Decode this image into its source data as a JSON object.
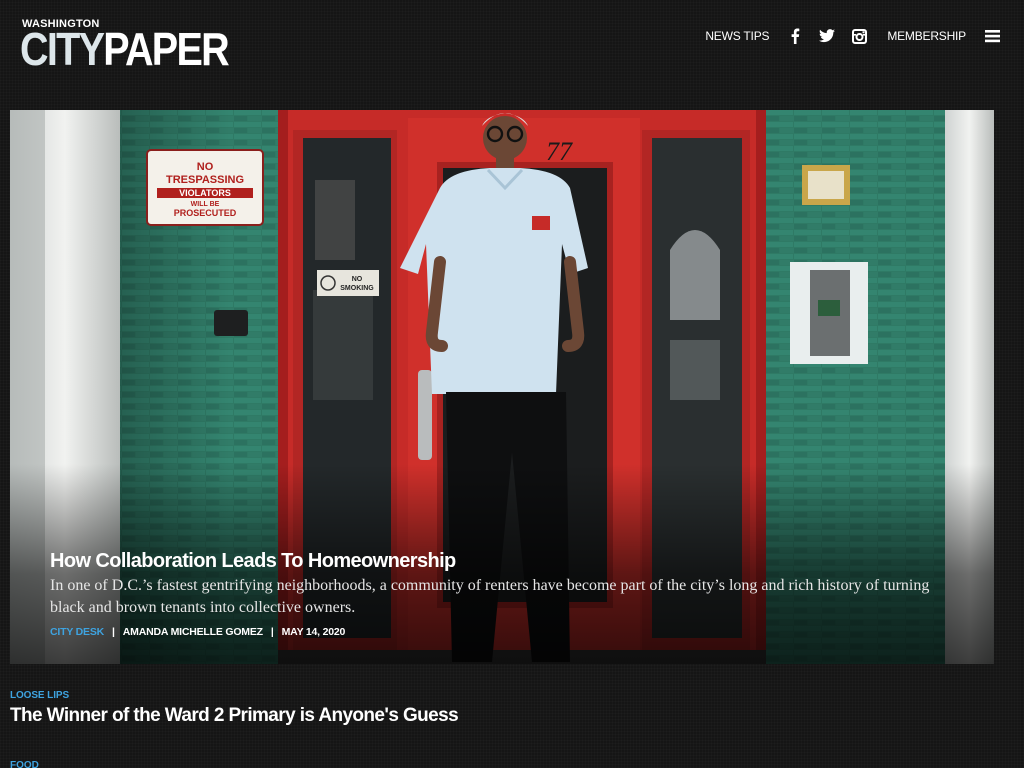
{
  "logo": {
    "small": "WASHINGTON",
    "city": "CITY",
    "paper": "PAPER"
  },
  "nav": {
    "news_tips": "NEWS TIPS",
    "membership": "MEMBERSHIP",
    "icons": [
      "facebook-icon",
      "twitter-icon",
      "instagram-icon",
      "menu-icon"
    ]
  },
  "hero": {
    "sign_no": "NO",
    "sign_trespassing": "TRESPASSING",
    "sign_violators": "VIOLATORS",
    "sign_will_be": "WILL BE",
    "sign_prosecuted": "PROSECUTED",
    "sign_no_smoking_1": "NO",
    "sign_no_smoking_2": "SMOKING",
    "door_number": "77",
    "title": "How Collaboration Leads To Homeownership",
    "description": "In one of D.C.’s fastest gentrifying neighborhoods, a community of renters have become part of the city’s long and rich history of turning black and brown tenants into collective owners.",
    "category": "CITY DESK",
    "separator": "|",
    "author": "AMANDA MICHELLE GOMEZ",
    "date": "MAY 14, 2020"
  },
  "stories": [
    {
      "category": "LOOSE LIPS",
      "title": "The Winner of the Ward 2 Primary is Anyone's Guess"
    },
    {
      "category": "FOOD"
    }
  ],
  "colors": {
    "accent": "#3ea3e0",
    "background": "#151515"
  }
}
